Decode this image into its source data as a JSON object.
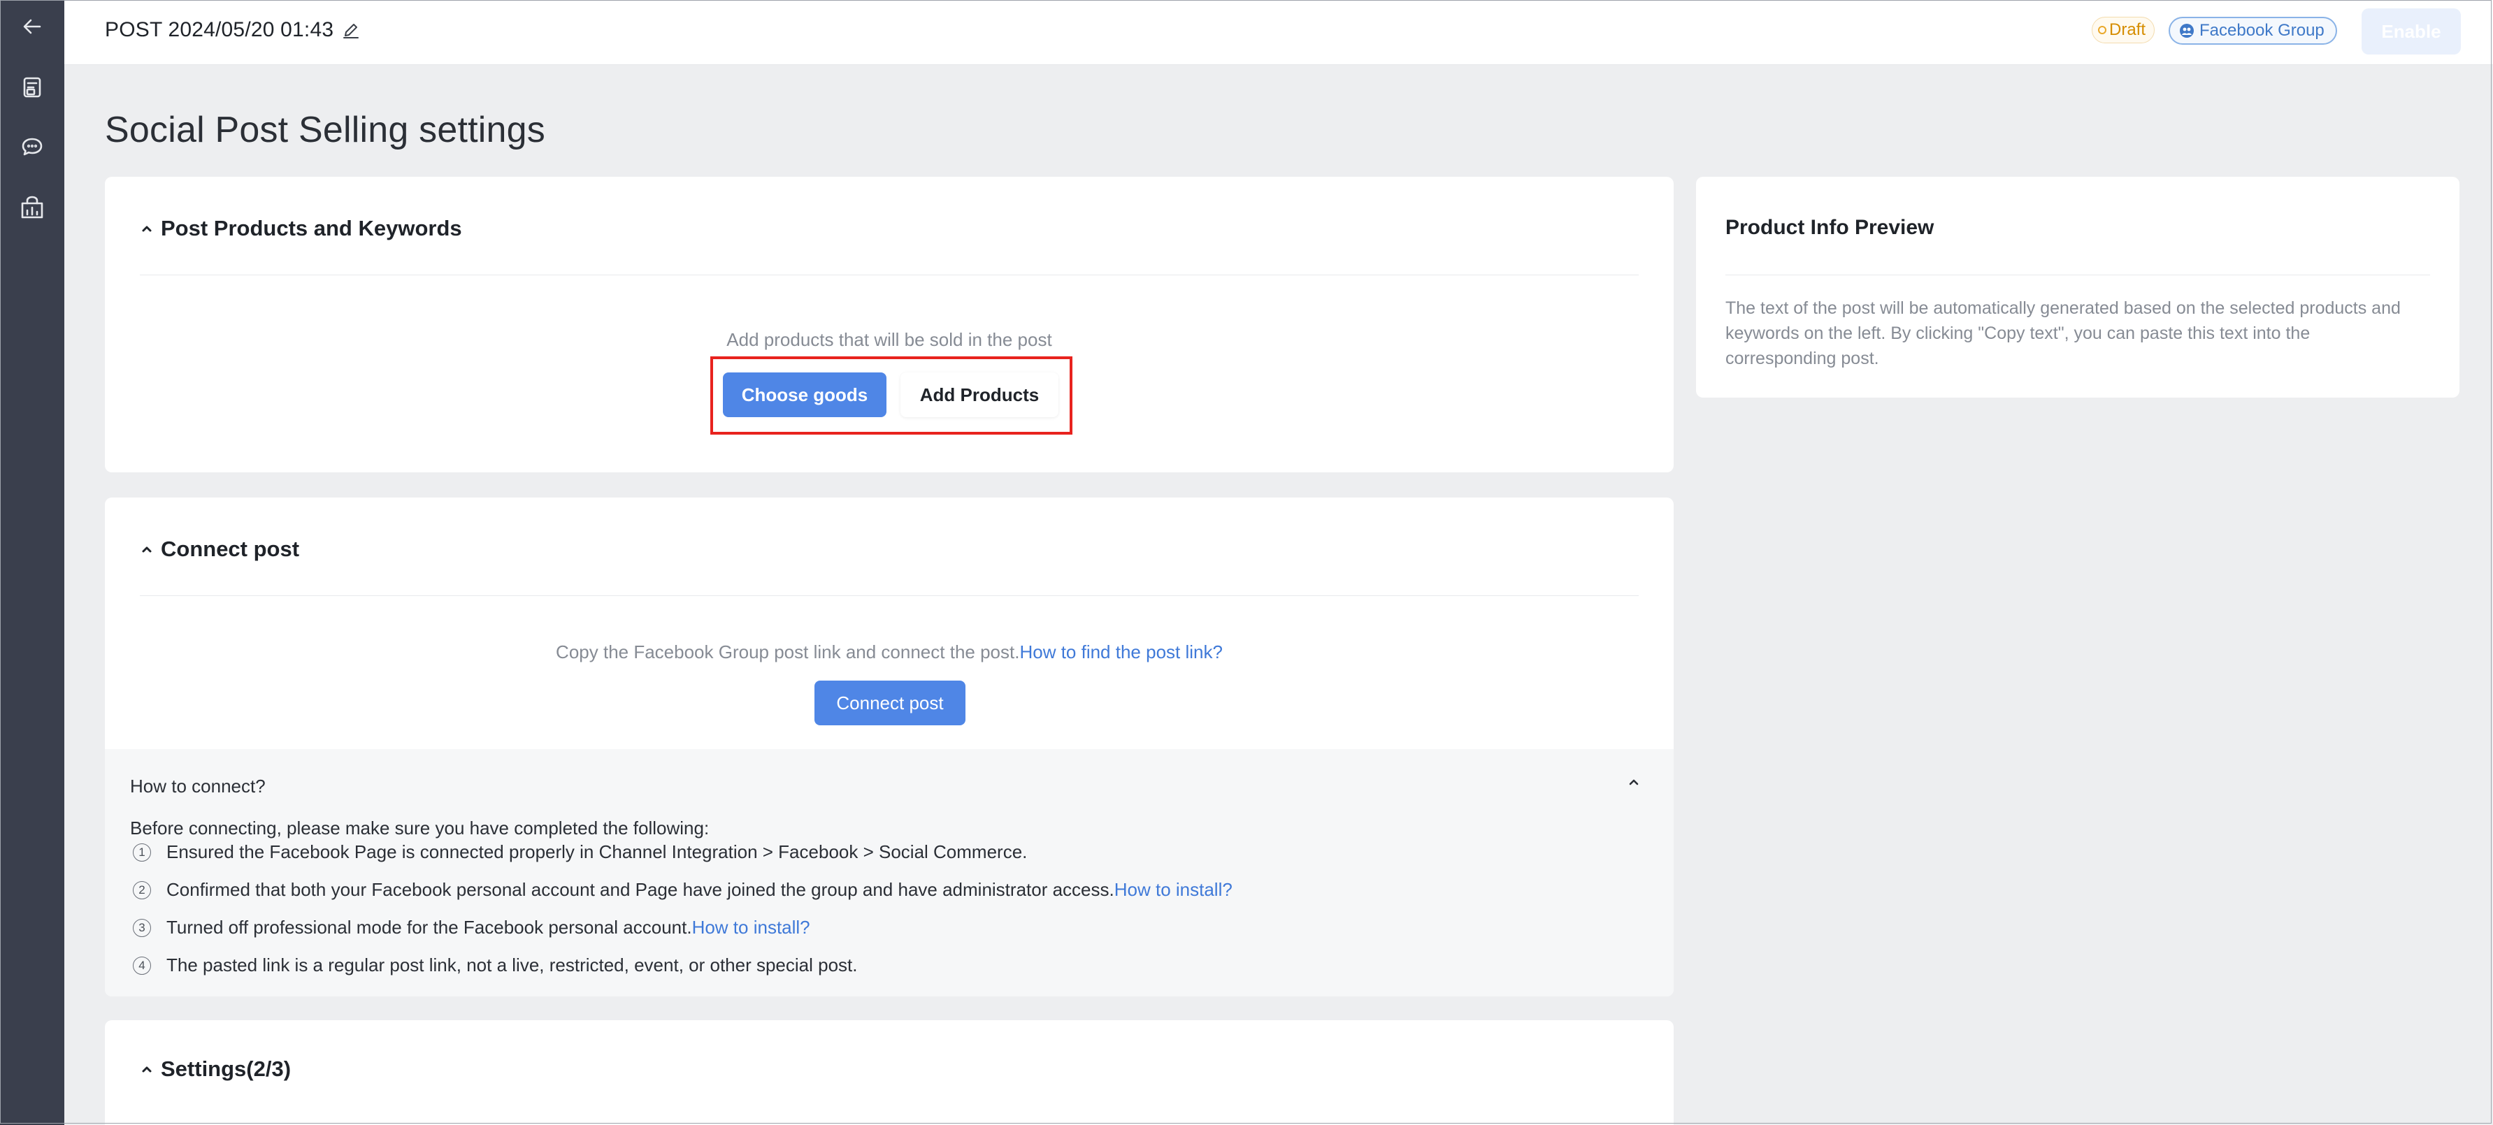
{
  "topbar": {
    "post_title": "POST 2024/05/20 01:43",
    "status_badge": "Draft",
    "channel_badge": "Facebook Group",
    "enable_label": "Enable"
  },
  "page": {
    "heading": "Social Post Selling settings"
  },
  "products_section": {
    "title": "Post Products and Keywords",
    "hint": "Add products that will be sold in the post",
    "choose_goods_label": "Choose goods",
    "add_products_label": "Add Products"
  },
  "preview": {
    "title": "Product Info Preview",
    "text": "The text of the post will be automatically generated based on the selected products and keywords on the left. By clicking \"Copy text\", you can paste this text into the corresponding post."
  },
  "connect_section": {
    "title": "Connect post",
    "hint": "Copy the Facebook Group post link and connect the post.",
    "hint_link": "How to find the post link?",
    "button_label": "Connect post",
    "howto": {
      "title": "How to connect?",
      "intro": "Before connecting, please make sure you have completed the following:",
      "steps": [
        {
          "num": "1",
          "text": "Ensured the Facebook Page is connected properly in Channel Integration > Facebook > Social Commerce.",
          "link": ""
        },
        {
          "num": "2",
          "text": "Confirmed that both your Facebook personal account and Page have joined the group and have administrator access.",
          "link": "How to install?"
        },
        {
          "num": "3",
          "text": "Turned off professional mode for the Facebook personal account.",
          "link": "How to install?"
        },
        {
          "num": "4",
          "text": "The pasted link is a regular post link, not a live, restricted, event, or other special post.",
          "link": ""
        }
      ]
    }
  },
  "settings_section": {
    "title": "Settings(2/3)"
  },
  "colors": {
    "primary": "#4f86e6",
    "link": "#3f79d8",
    "rail": "#3a3f4d",
    "draft": "#d68d00",
    "highlight": "#e8231e"
  },
  "icons": {
    "rail": [
      "back-arrow-icon",
      "document-icon",
      "chat-icon",
      "shop-analytics-icon"
    ],
    "edit": "pencil-icon",
    "collapse": "chevron-up-icon"
  }
}
